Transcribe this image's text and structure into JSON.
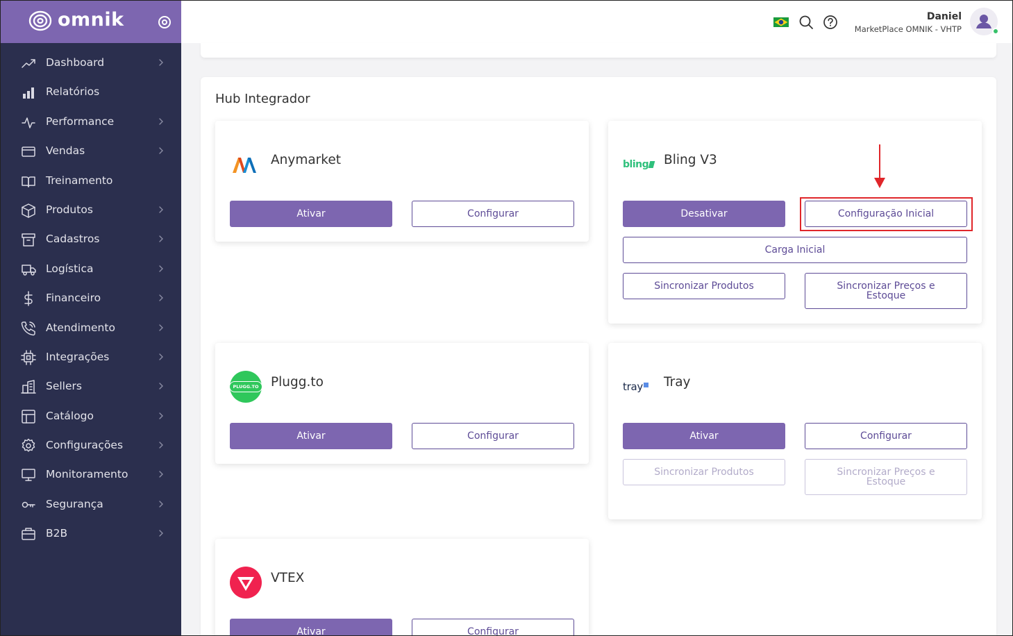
{
  "brand": {
    "name": "omnik"
  },
  "sidebar": {
    "items": [
      {
        "label": "Dashboard",
        "icon": "trending-up-icon",
        "chevron": true
      },
      {
        "label": "Relatórios",
        "icon": "bar-chart-icon",
        "chevron": false
      },
      {
        "label": "Performance",
        "icon": "activity-icon",
        "chevron": true
      },
      {
        "label": "Vendas",
        "icon": "credit-card-icon",
        "chevron": true
      },
      {
        "label": "Treinamento",
        "icon": "book-open-icon",
        "chevron": false
      },
      {
        "label": "Produtos",
        "icon": "box-icon",
        "chevron": true
      },
      {
        "label": "Cadastros",
        "icon": "archive-icon",
        "chevron": true
      },
      {
        "label": "Logística",
        "icon": "truck-icon",
        "chevron": true
      },
      {
        "label": "Financeiro",
        "icon": "dollar-icon",
        "chevron": true
      },
      {
        "label": "Atendimento",
        "icon": "phone-icon",
        "chevron": true
      },
      {
        "label": "Integrações",
        "icon": "cpu-icon",
        "chevron": true
      },
      {
        "label": "Sellers",
        "icon": "buildings-icon",
        "chevron": true
      },
      {
        "label": "Catálogo",
        "icon": "layout-icon",
        "chevron": true
      },
      {
        "label": "Configurações",
        "icon": "gear-icon",
        "chevron": true
      },
      {
        "label": "Monitoramento",
        "icon": "monitor-icon",
        "chevron": true
      },
      {
        "label": "Segurança",
        "icon": "key-icon",
        "chevron": true
      },
      {
        "label": "B2B",
        "icon": "briefcase-icon",
        "chevron": true
      }
    ]
  },
  "header": {
    "user_name": "Daniel",
    "user_org": "MarketPlace OMNIK - VHTP"
  },
  "main": {
    "title": "Hub Integrador",
    "cards": {
      "anymarket": {
        "title": "Anymarket",
        "activate": "Ativar",
        "configure": "Configurar"
      },
      "bling": {
        "title": "Bling V3",
        "logo_text": "bling",
        "deactivate": "Desativar",
        "initial_config": "Configuração Inicial",
        "initial_load": "Carga Inicial",
        "sync_products": "Sincronizar Produtos",
        "sync_prices": "Sincronizar Preços e Estoque"
      },
      "pluggto": {
        "title": "Plugg.to",
        "logo_text": "PLUGG.TO",
        "activate": "Ativar",
        "configure": "Configurar"
      },
      "tray": {
        "title": "Tray",
        "logo_text": "tray",
        "activate": "Ativar",
        "configure": "Configurar",
        "sync_products": "Sincronizar Produtos",
        "sync_prices": "Sincronizar Preços e Estoque"
      },
      "vtex": {
        "title": "VTEX",
        "activate": "Ativar",
        "configure": "Configurar"
      }
    }
  },
  "colors": {
    "primary": "#7d66b0",
    "sidebar_bg": "#2b2f4e",
    "highlight": "#e0262a"
  }
}
